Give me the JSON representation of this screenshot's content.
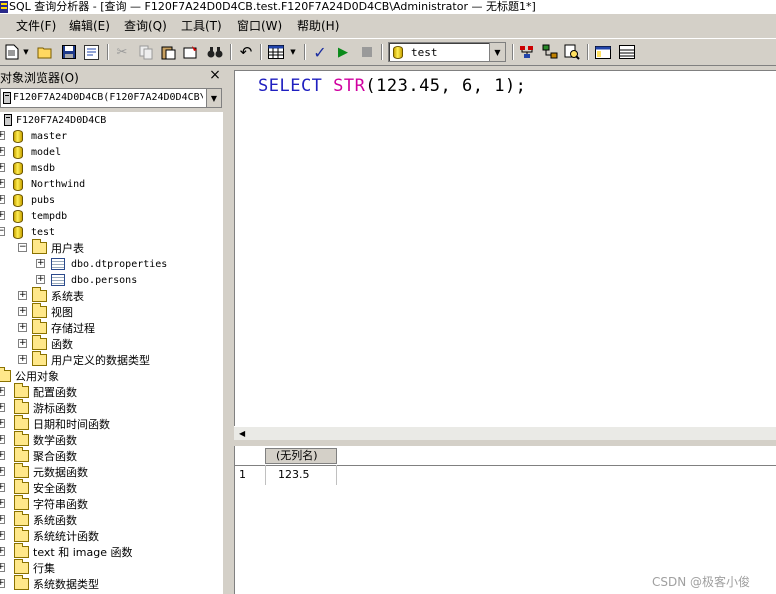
{
  "window": {
    "title": "SQL 查询分析器 - [查询 — F120F7A24D0D4CB.test.F120F7A24D0D4CB\\Administrator — 无标题1*]"
  },
  "menu": [
    {
      "label": "文件(F)"
    },
    {
      "label": "编辑(E)"
    },
    {
      "label": "查询(Q)"
    },
    {
      "label": "工具(T)"
    },
    {
      "label": "窗口(W)"
    },
    {
      "label": "帮助(H)"
    }
  ],
  "toolbar": {
    "database": "test"
  },
  "object_browser": {
    "title": "对象浏览器(O)",
    "close": "×",
    "server_select": "F120F7A24D0D4CB(F120F7A24D0D4CB\\",
    "tree": {
      "server": "F120F7A24D0D4CB",
      "databases": [
        "master",
        "model",
        "msdb",
        "Northwind",
        "pubs",
        "tempdb",
        "test"
      ],
      "user_tables_folder": "用户表",
      "user_tables": [
        "dbo.dtproperties",
        "dbo.persons"
      ],
      "test_folders": [
        "系统表",
        "视图",
        "存储过程",
        "函数",
        "用户定义的数据类型"
      ],
      "common_objects": "公用对象",
      "common_folders": [
        "配置函数",
        "游标函数",
        "日期和时间函数",
        "数学函数",
        "聚合函数",
        "元数据函数",
        "安全函数",
        "字符串函数",
        "系统函数",
        "系统统计函数",
        "text 和 image 函数",
        "行集",
        "系统数据类型"
      ]
    }
  },
  "editor": {
    "sql_keyword": "SELECT",
    "sql_function": "STR",
    "sql_rest": "(123.45, 6, 1);"
  },
  "results": {
    "column_header": "(无列名)",
    "rows": [
      {
        "num": "1",
        "value": "123.5"
      }
    ]
  },
  "watermark": "CSDN @极客小俊"
}
